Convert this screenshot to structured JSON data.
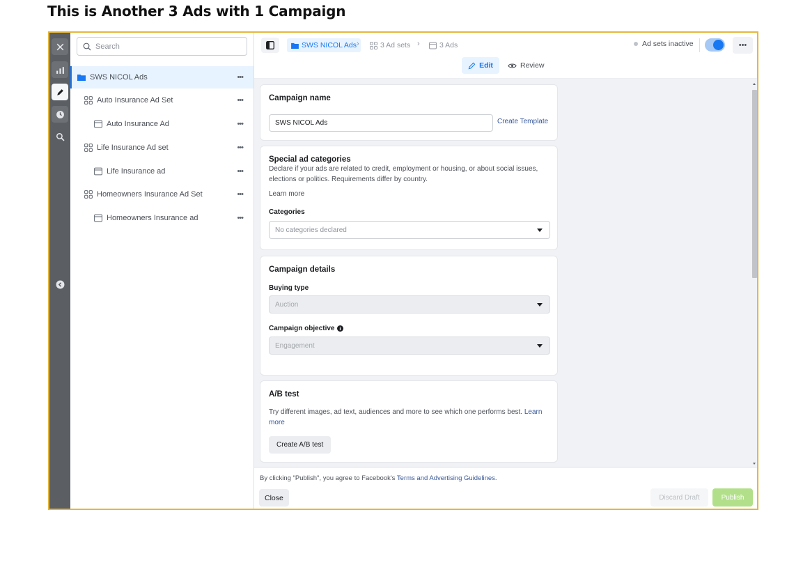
{
  "slide": {
    "title": "This is Another 3 Ads with 1 Campaign"
  },
  "rail": {
    "icons": [
      "close-icon",
      "chart-icon",
      "pencil-icon",
      "clock-icon",
      "search-zoom-icon",
      "chevron-left-circle-icon"
    ]
  },
  "tree": {
    "search_placeholder": "Search",
    "items": [
      {
        "label": "SWS NICOL Ads",
        "kind": "campaign",
        "more": "•••"
      },
      {
        "label": "Auto Insurance Ad Set",
        "kind": "adset",
        "more": "•••"
      },
      {
        "label": "Auto Insurance Ad",
        "kind": "ad",
        "more": "•••"
      },
      {
        "label": "Life Insurance Ad set",
        "kind": "adset",
        "more": "•••"
      },
      {
        "label": "Life Insurance ad",
        "kind": "ad",
        "more": "•••"
      },
      {
        "label": "Homeowners Insurance Ad Set",
        "kind": "adset",
        "more": "•••"
      },
      {
        "label": "Homeowners Insurance ad",
        "kind": "ad",
        "more": "•••"
      }
    ]
  },
  "topbar": {
    "breadcrumbs": [
      {
        "label": "SWS NICOL Ads",
        "icon": "folder-icon"
      },
      {
        "label": "3 Ad sets",
        "icon": "grid-icon"
      },
      {
        "label": "3 Ads",
        "icon": "ad-icon"
      }
    ],
    "status": "Ad sets inactive",
    "more": "•••",
    "edit_label": "Edit",
    "review_label": "Review"
  },
  "campaign_name": {
    "title": "Campaign name",
    "value": "SWS NICOL Ads",
    "template_link": "Create Template"
  },
  "special": {
    "title": "Special ad categories",
    "description": "Declare if your ads are related to credit, employment or housing, or about social issues, elections or politics. Requirements differ by country.",
    "learn_more": "Learn more",
    "categories_label": "Categories",
    "categories_placeholder": "No categories declared"
  },
  "details": {
    "title": "Campaign details",
    "buying_type_label": "Buying type",
    "buying_type_value": "Auction",
    "objective_label": "Campaign objective",
    "objective_value": "Engagement"
  },
  "ab_test": {
    "title": "A/B test",
    "description": "Try different images, ad text, audiences and more to see which one performs best.",
    "learn_more": "Learn more",
    "button": "Create A/B test"
  },
  "footer": {
    "legal_prefix": "By clicking \"Publish\", you agree to Facebook's",
    "legal_link": "Terms and Advertising Guidelines",
    "legal_suffix": ".",
    "close": "Close",
    "discard": "Discard Draft",
    "publish": "Publish"
  },
  "colors": {
    "accent": "#1877f2",
    "frame_border": "#e6b73a",
    "publish_disabled": "#b2e08a",
    "rail": "#5b5e63"
  }
}
